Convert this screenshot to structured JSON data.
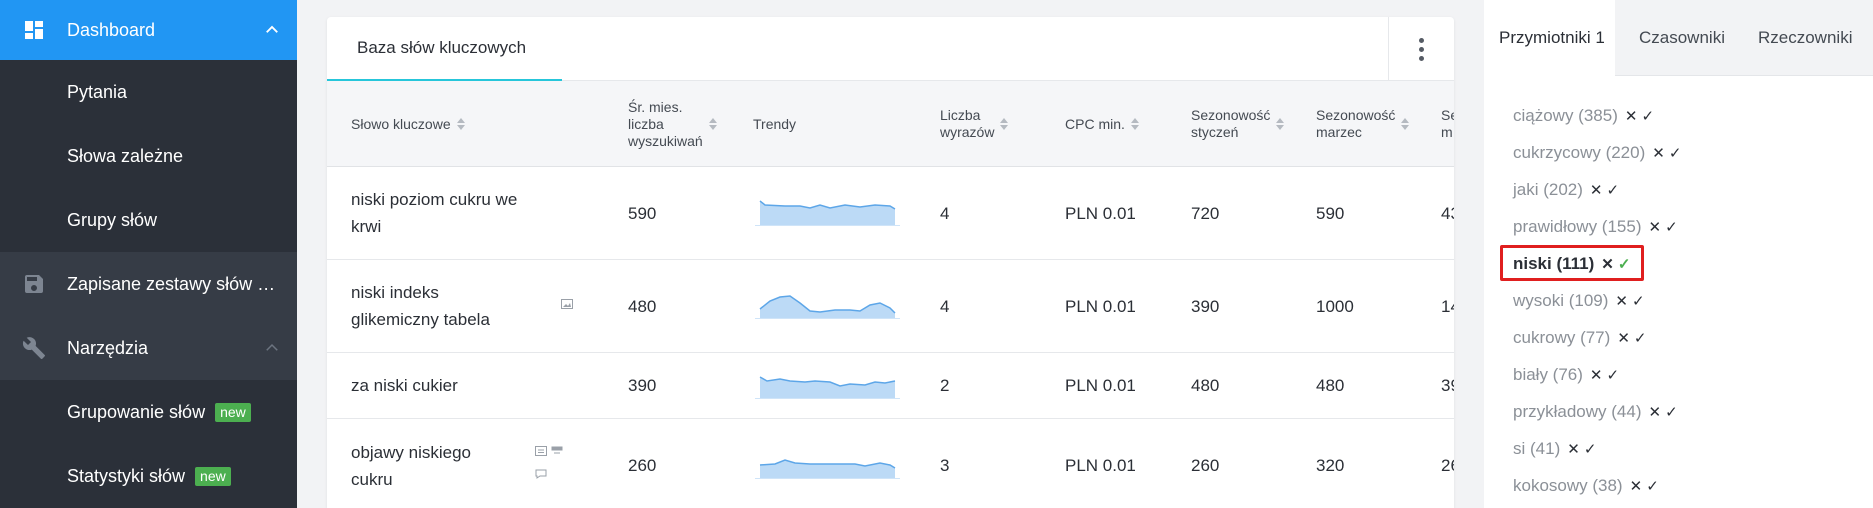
{
  "sidebar": {
    "items": [
      {
        "label": "Dashboard",
        "icon": "dashboard-icon"
      },
      {
        "label": "Pytania"
      },
      {
        "label": "Słowa zależne"
      },
      {
        "label": "Grupy słów"
      },
      {
        "label": "Zapisane zestawy słów kl...",
        "icon": "save-icon"
      },
      {
        "label": "Narzędzia",
        "icon": "wrench-icon"
      },
      {
        "label": "Grupowanie słów",
        "badge": "new"
      },
      {
        "label": "Statystyki słów",
        "badge": "new"
      }
    ]
  },
  "main": {
    "tab_label": "Baza słów kluczowych",
    "columns": {
      "keyword": "Słowo kluczowe",
      "avg_line1": "Śr. mies.",
      "avg_line2": "liczba",
      "avg_line3": "wyszukiwań",
      "trends": "Trendy",
      "words_line1": "Liczba",
      "words_line2": "wyrazów",
      "cpc": "CPC min.",
      "jan_line1": "Sezonowość",
      "jan_line2": "styczeń",
      "mar_line1": "Sezonowość",
      "mar_line2": "marzec",
      "next_line1": "Se",
      "next_line2": "m"
    },
    "rows": [
      {
        "kw1": "niski poziom cukru we",
        "kw2": "krwi",
        "avg": "590",
        "words": "4",
        "cpc": "PLN 0.01",
        "jan": "720",
        "mar": "590",
        "next": "43"
      },
      {
        "kw1": "niski indeks",
        "kw2": "glikemiczny tabela",
        "avg": "480",
        "words": "4",
        "cpc": "PLN 0.01",
        "jan": "390",
        "mar": "1000",
        "next": "14"
      },
      {
        "kw1": "za niski cukier",
        "kw2": "",
        "avg": "390",
        "words": "2",
        "cpc": "PLN 0.01",
        "jan": "480",
        "mar": "480",
        "next": "39"
      },
      {
        "kw1": "objawy niskiego",
        "kw2": "cukru",
        "avg": "260",
        "words": "3",
        "cpc": "PLN 0.01",
        "jan": "260",
        "mar": "320",
        "next": "26"
      }
    ]
  },
  "right_panel": {
    "tabs": [
      "Przymiotniki 1",
      "Czasowniki",
      "Rzeczowniki"
    ],
    "words": [
      "ciążowy (385)",
      "cukrzycowy (220)",
      "jaki (202)",
      "prawidłowy (155)",
      "niski (111)",
      "wysoki (109)",
      "cukrowy (77)",
      "biały (76)",
      "przykładowy (44)",
      "si (41)",
      "kokosowy (38)"
    ],
    "x_symbol": "✕",
    "check_symbol": "✓"
  },
  "colors": {
    "accent": "#2196f3",
    "tab_underline": "#26c6da",
    "sidebar_bg": "#2b3039",
    "badge_green": "#4caf50",
    "highlight_red": "#e01f1f",
    "spark_fill": "#bcdaf6",
    "spark_line": "#5da6e8"
  }
}
